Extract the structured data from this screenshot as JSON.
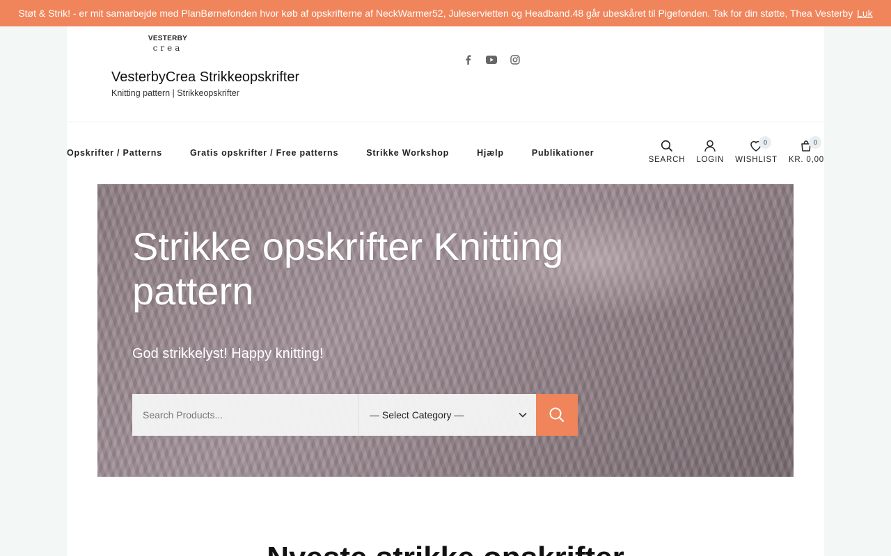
{
  "notice": {
    "text": "Støt & Strik! - er mit samarbejde med PlanBørnefonden hvor køb af opskrifterne af NeckWarmer52, Juleservietten og Headband.48 går ubeskåret til Pigefonden. Tak for din støtte, Thea Vesterby",
    "close_label": "Luk",
    "bg_color": "#f0845a"
  },
  "header": {
    "logo_line1": "VESTERBY",
    "logo_line2": "crea",
    "site_title": "VesterbyCrea Strikkeopskrifter",
    "tagline": "Knitting pattern | Strikkeopskrifter",
    "social_icons": [
      "facebook-icon",
      "youtube-icon",
      "instagram-icon"
    ]
  },
  "nav": {
    "items": [
      "Opskrifter / Patterns",
      "Gratis opskrifter / Free patterns",
      "Strikke Workshop",
      "Hjælp",
      "Publikationer"
    ]
  },
  "tools": {
    "search_label": "SEARCH",
    "login_label": "LOGIN",
    "wishlist_label": "WISHLIST",
    "wishlist_count": "0",
    "cart_label": "KR. 0,00",
    "cart_count": "0"
  },
  "hero": {
    "title": "Strikke opskrifter Knitting pattern",
    "subtitle": "God strikkelyst! Happy knitting!",
    "search_placeholder": "Search Products...",
    "category_selected": "— Select Category —",
    "accent_color": "#f0845a"
  },
  "section": {
    "heading_partial": "Nyeste strikke opskrifter"
  }
}
